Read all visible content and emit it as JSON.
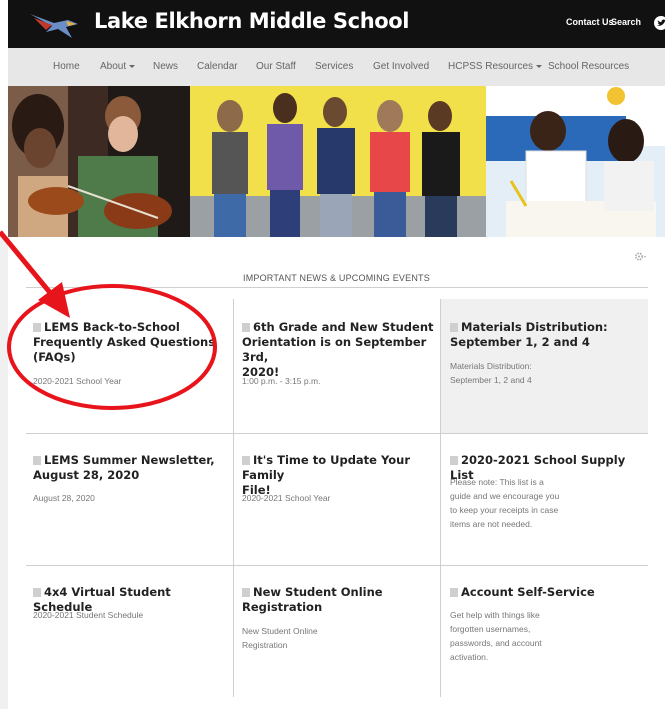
{
  "header": {
    "title": "Lake Elkhorn Middle School",
    "contact_label": "Contact Us",
    "search_label": "Search"
  },
  "nav": {
    "items": [
      {
        "label": "Home"
      },
      {
        "label": "About"
      },
      {
        "label": "News"
      },
      {
        "label": "Calendar"
      },
      {
        "label": "Our Staff"
      },
      {
        "label": "Services"
      },
      {
        "label": "Get Involved"
      },
      {
        "label": "HCPSS Resources"
      },
      {
        "label": "School Resources"
      }
    ]
  },
  "section": {
    "heading": "IMPORTANT NEWS & UPCOMING EVENTS"
  },
  "cards": [
    {
      "title_lines": [
        "LEMS Back-to-School",
        "Frequently Asked Questions",
        "(FAQs)"
      ],
      "sub_lines": [
        "2020-2021 School Year"
      ]
    },
    {
      "title_lines": [
        "6th Grade and New Student",
        "Orientation is on September 3rd,",
        "2020!"
      ],
      "sub_lines": [
        "1:00 p.m. - 3:15 p.m."
      ]
    },
    {
      "title_lines": [
        "Materials Distribution:",
        "September 1, 2 and 4"
      ],
      "sub_lines": [
        "Materials Distribution:",
        "September 1, 2 and 4"
      ]
    },
    {
      "title_lines": [
        "LEMS Summer Newsletter,",
        "August 28, 2020"
      ],
      "sub_lines": [
        "August 28, 2020"
      ]
    },
    {
      "title_lines": [
        "It's Time to Update Your Family",
        "File!"
      ],
      "sub_lines": [
        "2020-2021 School Year"
      ]
    },
    {
      "title_lines": [
        "2020-2021 School Supply List"
      ],
      "sub_lines": [
        "Please note: This list is a",
        "guide and we encourage you",
        "to keep your receipts in case",
        "items are not needed."
      ]
    },
    {
      "title_lines": [
        "4x4 Virtual Student Schedule"
      ],
      "sub_lines": [
        "2020-2021 Student Schedule"
      ]
    },
    {
      "title_lines": [
        "New Student Online",
        "Registration"
      ],
      "sub_lines": [
        "New Student Online",
        "Registration"
      ]
    },
    {
      "title_lines": [
        "Account Self-Service"
      ],
      "sub_lines": [
        "Get help with things like",
        "forgotten usernames,",
        "passwords, and account",
        "activation."
      ]
    }
  ],
  "colors": {
    "header_bg": "#111111",
    "nav_bg": "#e7e7e7",
    "highlight_cell": "#f0f0f0",
    "annotation_red": "#e8141b"
  },
  "icons": [
    "hawk-logo-icon",
    "twitter-icon",
    "gear-icon",
    "flag-icon"
  ]
}
